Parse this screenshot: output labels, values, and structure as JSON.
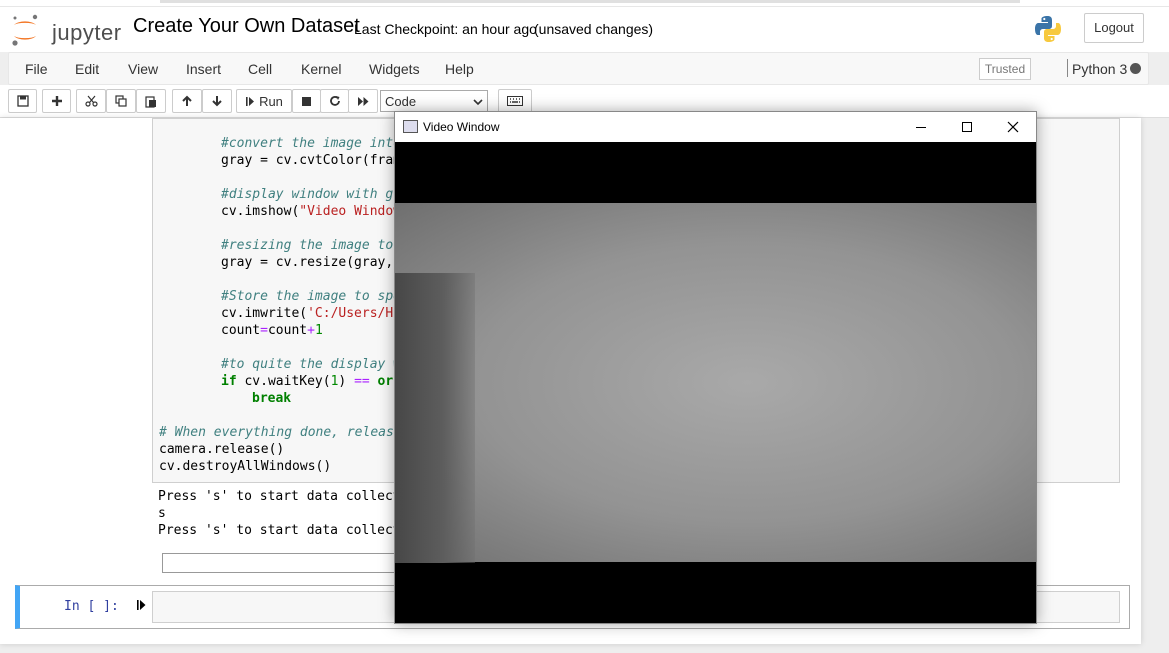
{
  "header": {
    "logo_text": "jupyter",
    "notebook_name": "Create Your Own Dataset",
    "checkpoint": "Last Checkpoint: an hour ago",
    "autosave_status": "(unsaved changes)",
    "logout_label": "Logout"
  },
  "menubar": {
    "items": [
      "File",
      "Edit",
      "View",
      "Insert",
      "Cell",
      "Kernel",
      "Widgets",
      "Help"
    ],
    "trusted_label": "Trusted",
    "kernel_name": "Python 3"
  },
  "toolbar": {
    "run_label": "Run",
    "cell_type": "Code",
    "icons": [
      "save-icon",
      "plus-icon",
      "cut-icon",
      "copy-icon",
      "paste-icon",
      "arrow-up-icon",
      "arrow-down-icon",
      "run-icon",
      "stop-icon",
      "restart-icon",
      "fast-forward-icon",
      "keyboard-icon"
    ]
  },
  "code": {
    "line1_comment": "#convert the image into",
    "line2_a": "gray = cv.cvtColor(fram",
    "line3_comment": "#display window with gr",
    "line4_a": "cv.imshow(",
    "line4_str": "\"Video Window",
    "line5_comment": "#resizing the image to",
    "line6_a": "gray = cv.resize(gray,",
    "line7_comment": "#Store the image to spe",
    "line8_a": "cv.imwrite(",
    "line8_str": "'C:/Users/HP",
    "line9_a": "count",
    "line9_op": "=",
    "line9_b": "count",
    "line9_op2": "+",
    "line9_num": "1",
    "line10_comment": "#to quite the display w",
    "line11_kw": "if",
    "line11_a": " cv.waitKey(",
    "line11_num": "1",
    "line11_b": ") ",
    "line11_op": "==",
    "line11_c": " orc",
    "line12_kw": "break",
    "line13_comment": "# When everything done, release",
    "line14": "camera.release()",
    "line15": "cv.destroyAllWindows()"
  },
  "output": {
    "line1": "Press 's' to start data collect",
    "line2": "s",
    "line3": "Press 's' to start data collect"
  },
  "empty_cell": {
    "prompt": "In [ ]:"
  },
  "video_window": {
    "title": "Video Window"
  }
}
